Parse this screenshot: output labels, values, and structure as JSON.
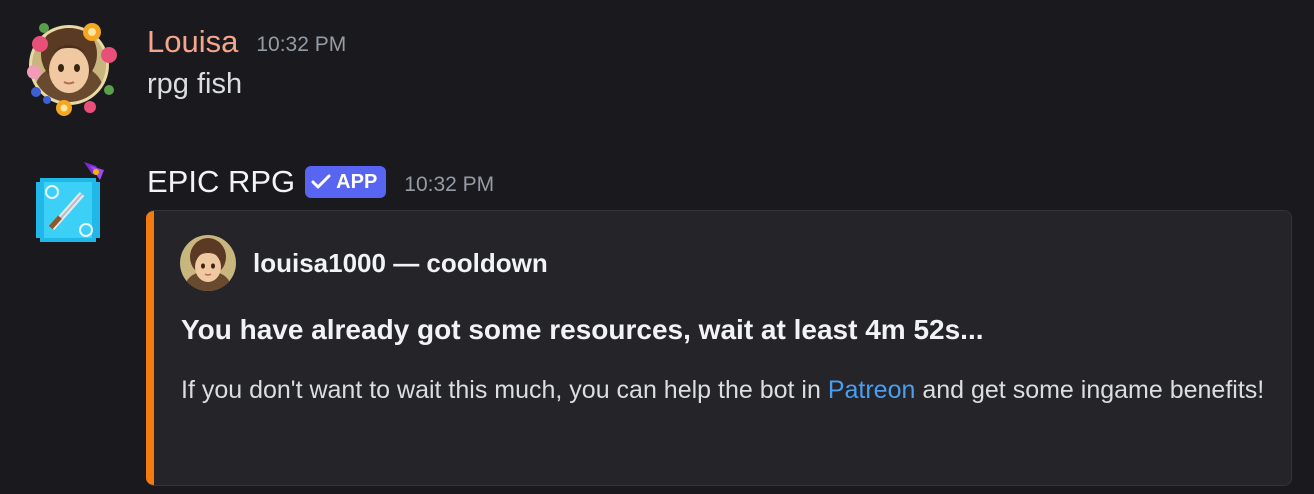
{
  "messages": [
    {
      "author": "Louisa",
      "timestamp": "10:32 PM",
      "content": "rpg fish",
      "avatar_icon": "girl-avatar-with-fruit-frame"
    },
    {
      "author": "EPIC RPG",
      "badge": "APP",
      "timestamp": "10:32 PM",
      "avatar_icon": "sword-pixel-avatar",
      "embed": {
        "accent_color": "#f47b0f",
        "author_name": "louisa1000 — cooldown",
        "title": "You have already got some resources, wait at least 4m 52s...",
        "description_before": "If you don't want to wait this much, you can help the bot in ",
        "description_link": "Patreon",
        "description_after": " and get some ingame benefits!"
      }
    }
  ],
  "colors": {
    "background": "#1a1a1e",
    "louisa_name": "#f4a58b",
    "app_badge": "#5865f2",
    "link": "#4a9ef0"
  }
}
